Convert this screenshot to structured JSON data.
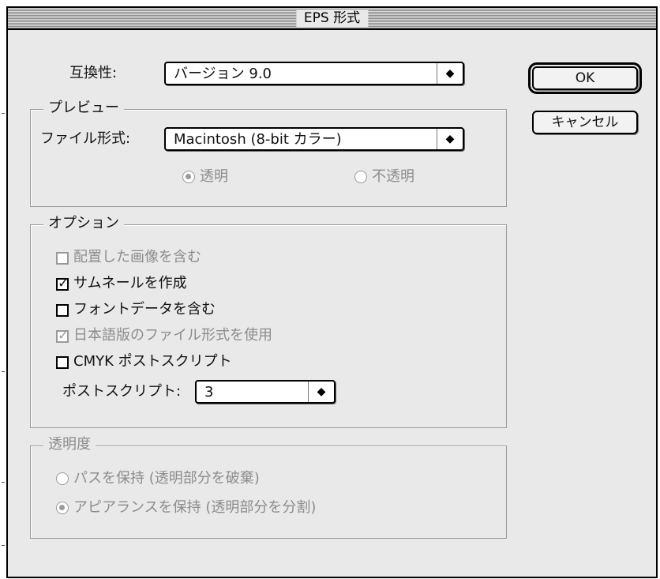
{
  "window": {
    "title": "EPS 形式"
  },
  "compatibility": {
    "label": "互換性:",
    "value": "バージョン 9.0"
  },
  "buttons": {
    "ok": "OK",
    "cancel": "キャンセル"
  },
  "preview": {
    "legend": "プレビュー",
    "format_label": "ファイル形式:",
    "format_value": "Macintosh (8-bit カラー)",
    "radio_transparent": "透明",
    "radio_opaque": "不透明",
    "transparent_selected": true
  },
  "options": {
    "legend": "オプション",
    "items": [
      {
        "label": "配置した画像を含む",
        "checked": false,
        "enabled": false
      },
      {
        "label": "サムネールを作成",
        "checked": true,
        "enabled": true
      },
      {
        "label": "フォントデータを含む",
        "checked": false,
        "enabled": true
      },
      {
        "label": "日本語版のファイル形式を使用",
        "checked": true,
        "enabled": false
      },
      {
        "label": "CMYK ポストスクリプト",
        "checked": false,
        "enabled": true
      }
    ],
    "postscript_label": "ポストスクリプト:",
    "postscript_value": "3"
  },
  "transparency": {
    "legend": "透明度",
    "radio_preserve_paths": "パスを保持 (透明部分を破棄)",
    "radio_preserve_appearance": "アピアランスを保持 (透明部分を分割)",
    "appearance_selected": true
  },
  "icons": {
    "popup_arrow": "up-down-arrows",
    "checkbox_mark": "checkmark"
  }
}
